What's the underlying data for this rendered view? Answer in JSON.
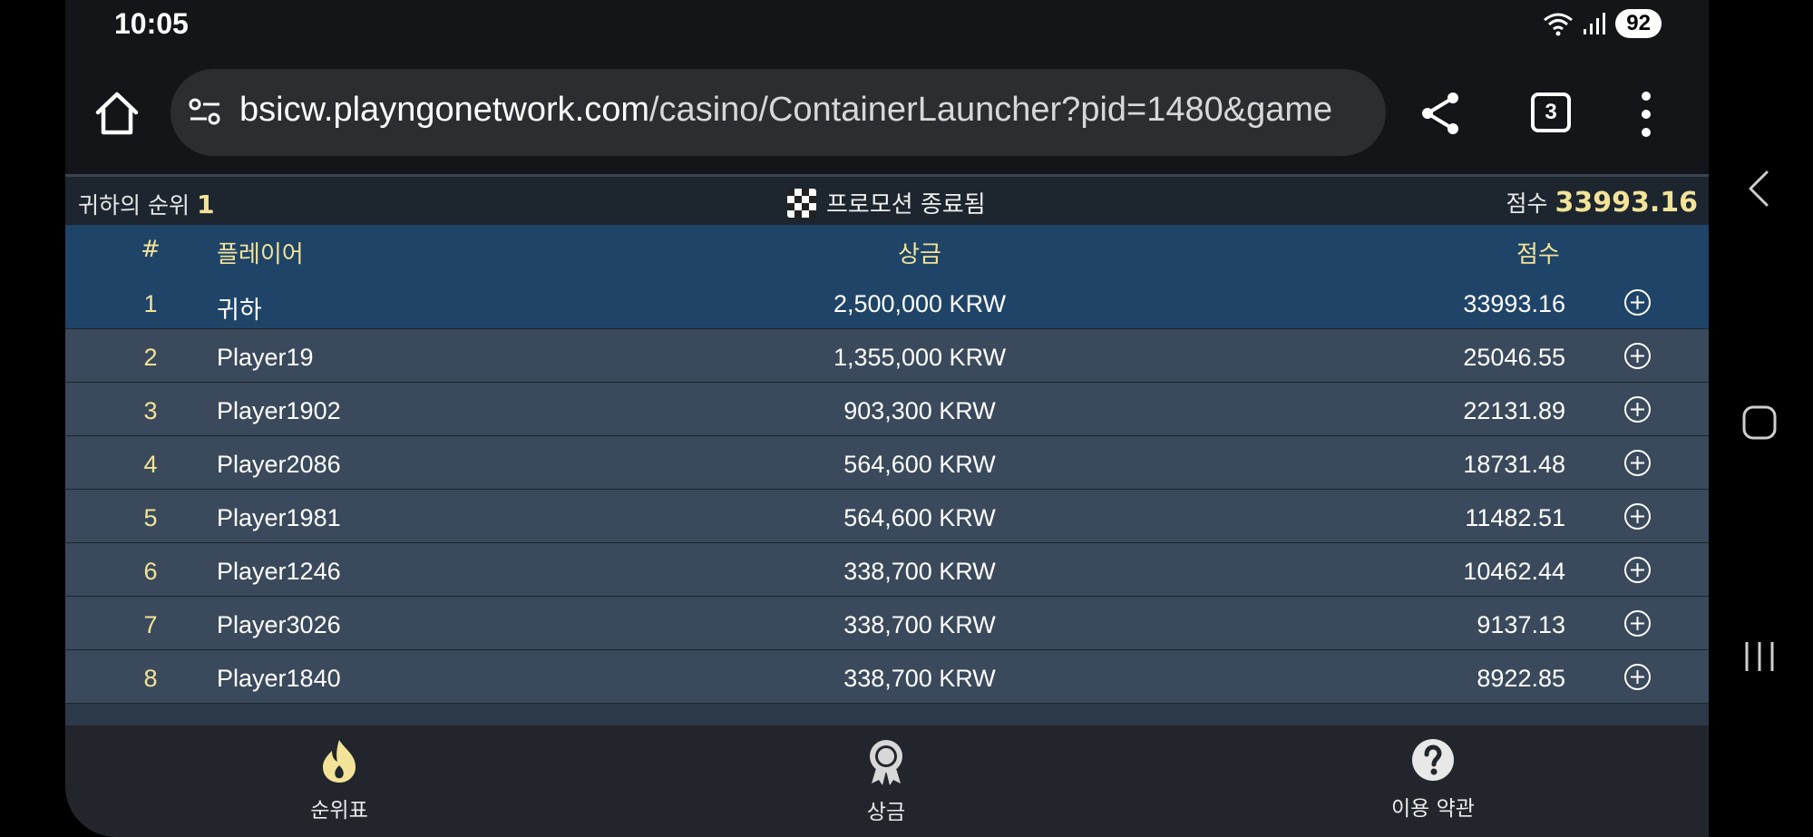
{
  "status_bar": {
    "time": "10:05",
    "battery": "92"
  },
  "browser": {
    "url_host": "bsicw.playngonetwork.com",
    "url_path": "/casino/ContainerLauncher?pid=1480&game",
    "tab_count": "3"
  },
  "leaderboard": {
    "summary": {
      "rank_label": "귀하의 순위",
      "rank_value": "1",
      "status": "프로모션 종료됨",
      "score_label": "점수",
      "score_value": "33993.16"
    },
    "headers": {
      "rank": "#",
      "player": "플레이어",
      "prize": "상금",
      "score": "점수"
    },
    "rows": [
      {
        "rank": "1",
        "player": "귀하",
        "prize": "2,500,000 KRW",
        "score": "33993.16",
        "is_me": true
      },
      {
        "rank": "2",
        "player": "Player19",
        "prize": "1,355,000 KRW",
        "score": "25046.55"
      },
      {
        "rank": "3",
        "player": "Player1902",
        "prize": "903,300 KRW",
        "score": "22131.89"
      },
      {
        "rank": "4",
        "player": "Player2086",
        "prize": "564,600 KRW",
        "score": "18731.48"
      },
      {
        "rank": "5",
        "player": "Player1981",
        "prize": "564,600 KRW",
        "score": "11482.51"
      },
      {
        "rank": "6",
        "player": "Player1246",
        "prize": "338,700 KRW",
        "score": "10462.44"
      },
      {
        "rank": "7",
        "player": "Player3026",
        "prize": "338,700 KRW",
        "score": "9137.13"
      },
      {
        "rank": "8",
        "player": "Player1840",
        "prize": "338,700 KRW",
        "score": "8922.85"
      }
    ]
  },
  "bottom_nav": [
    {
      "label": "순위표",
      "icon": "flame-icon"
    },
    {
      "label": "상금",
      "icon": "medal-icon"
    },
    {
      "label": "이용 약관",
      "icon": "help-icon"
    }
  ],
  "colors": {
    "accent_gold": "#f2e398",
    "header_blue": "#1f4468",
    "row_slate": "#3a4a5c"
  }
}
